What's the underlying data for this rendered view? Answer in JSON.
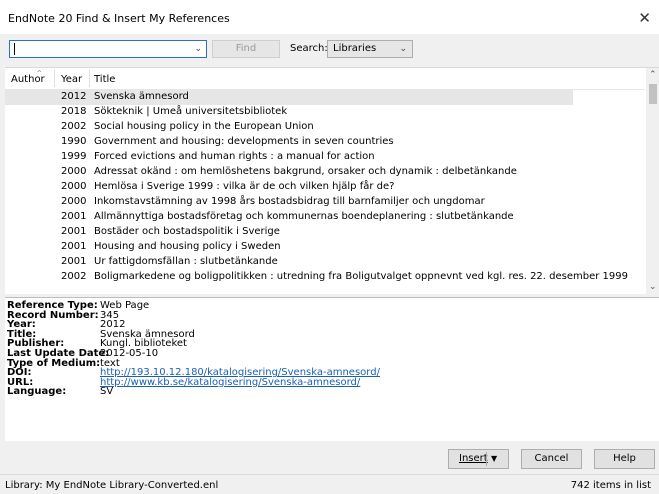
{
  "window": {
    "title": "EndNote 20 Find & Insert My References",
    "close_label": "✕"
  },
  "search": {
    "query": "",
    "find_label": "Find",
    "search_label": "Search:",
    "scope": "Libraries"
  },
  "list": {
    "headers": {
      "author": "Author",
      "year": "Year",
      "title": "Title"
    },
    "rows": [
      {
        "year": "2012",
        "title": "Svenska ämnesord",
        "selected": true
      },
      {
        "year": "2018",
        "title": "Sökteknik | Umeå universitetsbibliotek"
      },
      {
        "year": "2002",
        "title": "Social housing policy in the European Union"
      },
      {
        "year": "1990",
        "title": "Government and housing: developments in seven countries"
      },
      {
        "year": "1999",
        "title": "Forced evictions and human rights : a manual for action"
      },
      {
        "year": "2000",
        "title": "Adressat okänd : om hemlöshetens bakgrund, orsaker och dynamik : delbetänkande"
      },
      {
        "year": "2000",
        "title": "Hemlösa i Sverige 1999 : vilka är de och vilken hjälp får de?"
      },
      {
        "year": "2000",
        "title": "Inkomstavstämning av 1998 års bostadsbidrag till barnfamiljer och ungdomar"
      },
      {
        "year": "2001",
        "title": "Allmännyttiga bostadsföretag och kommunernas boendeplanering : slutbetänkande"
      },
      {
        "year": "2001",
        "title": "Bostäder och bostadspolitik i Sverige"
      },
      {
        "year": "2001",
        "title": "Housing and housing policy i Sweden"
      },
      {
        "year": "2001",
        "title": "Ur fattigdomsfällan : slutbetänkande"
      },
      {
        "year": "2002",
        "title": "Boligmarkedene og boligpolitikken : utredning fra Boligutvalget oppnevnt ved kgl. res. 22. desember 1999"
      }
    ]
  },
  "details": [
    {
      "label": "Reference Type:",
      "value": "Web Page"
    },
    {
      "label": "Record Number:",
      "value": "345"
    },
    {
      "label": "Year:",
      "value": "2012"
    },
    {
      "label": "Title:",
      "value": "Svenska ämnesord"
    },
    {
      "label": "Publisher:",
      "value": "Kungl. biblioteket"
    },
    {
      "label": "Last Update Date:",
      "value": "2012-05-10"
    },
    {
      "label": "Type of Medium:",
      "value": "text"
    },
    {
      "label": "DOI:",
      "value": "http://193.10.12.180/katalogisering/Svenska-amnesord/",
      "link": true
    },
    {
      "label": "URL:",
      "value": "http://www.kb.se/katalogisering/Svenska-amnesord/",
      "link": true
    },
    {
      "label": "Language:",
      "value": "SV"
    }
  ],
  "buttons": {
    "insert": "Insert",
    "cancel": "Cancel",
    "help": "Help"
  },
  "status": {
    "library": "Library: My EndNote Library-Converted.enl",
    "count": "742 items in list"
  }
}
